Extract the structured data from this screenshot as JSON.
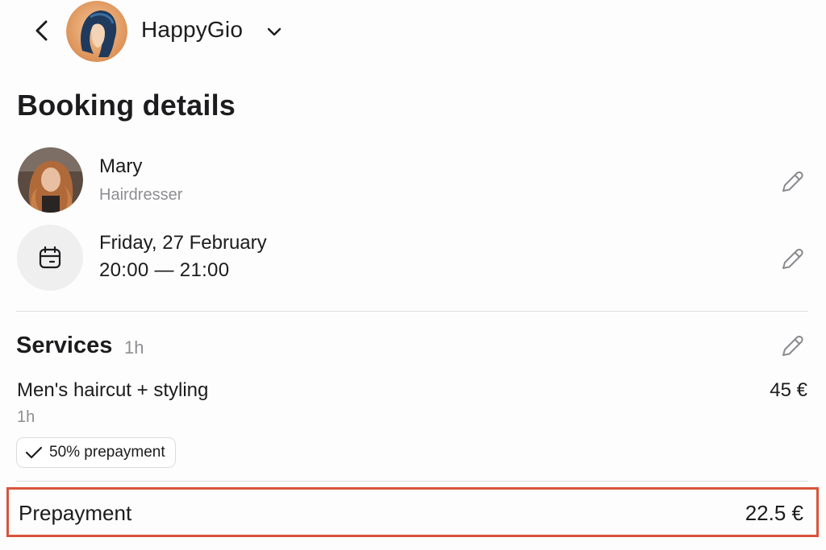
{
  "header": {
    "back_icon": "chevron-left-icon",
    "salon_name": "HappyGio",
    "salon_chevron_icon": "chevron-down-icon"
  },
  "page_title": "Booking details",
  "specialist": {
    "name": "Mary",
    "role": "Hairdresser",
    "edit_icon": "pencil-icon"
  },
  "appointment": {
    "date": "Friday, 27 February",
    "time": "20:00 — 21:00",
    "icon": "calendar-icon",
    "edit_icon": "pencil-icon"
  },
  "services": {
    "title": "Services",
    "total_duration": "1h",
    "edit_icon": "pencil-icon",
    "items": [
      {
        "name": "Men's haircut + styling",
        "price": "45 €",
        "duration": "1h",
        "badge": "50% prepayment",
        "badge_icon": "checkmark-icon"
      }
    ]
  },
  "prepayment": {
    "label": "Prepayment",
    "amount": "22.5 €"
  },
  "colors": {
    "highlight": "#d9543a",
    "secondary_text": "#8e8e93",
    "calendar_bg": "#efeff0"
  }
}
